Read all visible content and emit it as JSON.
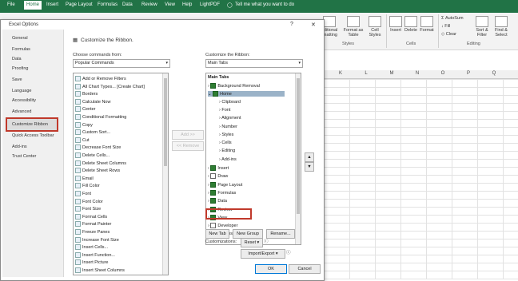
{
  "excel": {
    "tabs": [
      "File",
      "Home",
      "Insert",
      "Page Layout",
      "Formulas",
      "Data",
      "Review",
      "View",
      "Help",
      "LightPDF"
    ],
    "tell_me": "Tell me what you want to do",
    "ribbon": {
      "cond_format": "nditional\nrmatting",
      "format_table": "Format as\nTable",
      "cell_styles": "Cell\nStyles",
      "insert": "Insert",
      "delete": "Delete",
      "format": "Format",
      "autosum": "AutoSum",
      "fill": "Fill",
      "clear": "Clear",
      "sort_filter": "Sort &\nFilter",
      "find_select": "Find &\nSelect",
      "grp_styles": "Styles",
      "grp_cells": "Cells",
      "grp_editing": "Editing"
    },
    "columns": [
      "K",
      "L",
      "M",
      "N",
      "O",
      "P",
      "Q"
    ]
  },
  "dialog": {
    "title": "Excel Options",
    "help": "?",
    "close": "✕",
    "nav": [
      "General",
      "Formulas",
      "Data",
      "Proofing",
      "Save",
      "Language",
      "Accessibility",
      "Advanced",
      "Customize Ribbon",
      "Quick Access Toolbar",
      "Add-ins",
      "Trust Center"
    ],
    "heading": "Customize the Ribbon.",
    "choose_label": "Choose commands from:",
    "choose_value": "Popular Commands",
    "customize_label": "Customize the Ribbon:",
    "customize_value": "Main Tabs",
    "commands": [
      "Add or Remove Filters",
      "All Chart Types... [Create Chart]",
      "Borders",
      "Calculate Now",
      "Center",
      "Conditional Formatting",
      "Copy",
      "Custom Sort...",
      "Cut",
      "Decrease Font Size",
      "Delete Cells...",
      "Delete Sheet Columns",
      "Delete Sheet Rows",
      "Email",
      "Fill Color",
      "Font",
      "Font Color",
      "Font Size",
      "Format Cells",
      "Format Painter",
      "Freeze Panes",
      "Increase Font Size",
      "Insert Cells...",
      "Insert Function...",
      "Insert Picture",
      "Insert Sheet Columns"
    ],
    "tree_header": "Main Tabs",
    "tree": [
      {
        "label": "Background Removal",
        "level": 0,
        "checked": true
      },
      {
        "label": "Home",
        "level": 0,
        "checked": true,
        "selected": true
      },
      {
        "label": "Clipboard",
        "level": 1
      },
      {
        "label": "Font",
        "level": 1
      },
      {
        "label": "Alignment",
        "level": 1
      },
      {
        "label": "Number",
        "level": 1
      },
      {
        "label": "Styles",
        "level": 1
      },
      {
        "label": "Cells",
        "level": 1
      },
      {
        "label": "Editing",
        "level": 1
      },
      {
        "label": "Add-ins",
        "level": 1
      },
      {
        "label": "Insert",
        "level": 0,
        "checked": true
      },
      {
        "label": "Draw",
        "level": 0,
        "checked": false
      },
      {
        "label": "Page Layout",
        "level": 0,
        "checked": true
      },
      {
        "label": "Formulas",
        "level": 0,
        "checked": true
      },
      {
        "label": "Data",
        "level": 0,
        "checked": true
      },
      {
        "label": "Review",
        "level": 0,
        "checked": true
      },
      {
        "label": "View",
        "level": 0,
        "checked": true
      },
      {
        "label": "Developer",
        "level": 0,
        "checked": false
      },
      {
        "label": "Add-ins",
        "level": 0,
        "checked": true
      }
    ],
    "add_btn": "Add >>",
    "remove_btn": "<< Remove",
    "new_tab": "New Tab",
    "new_group": "New Group",
    "rename": "Rename...",
    "customizations": "Customizations:",
    "reset": "Reset",
    "import_export": "Import/Export",
    "ok": "OK",
    "cancel": "Cancel"
  }
}
